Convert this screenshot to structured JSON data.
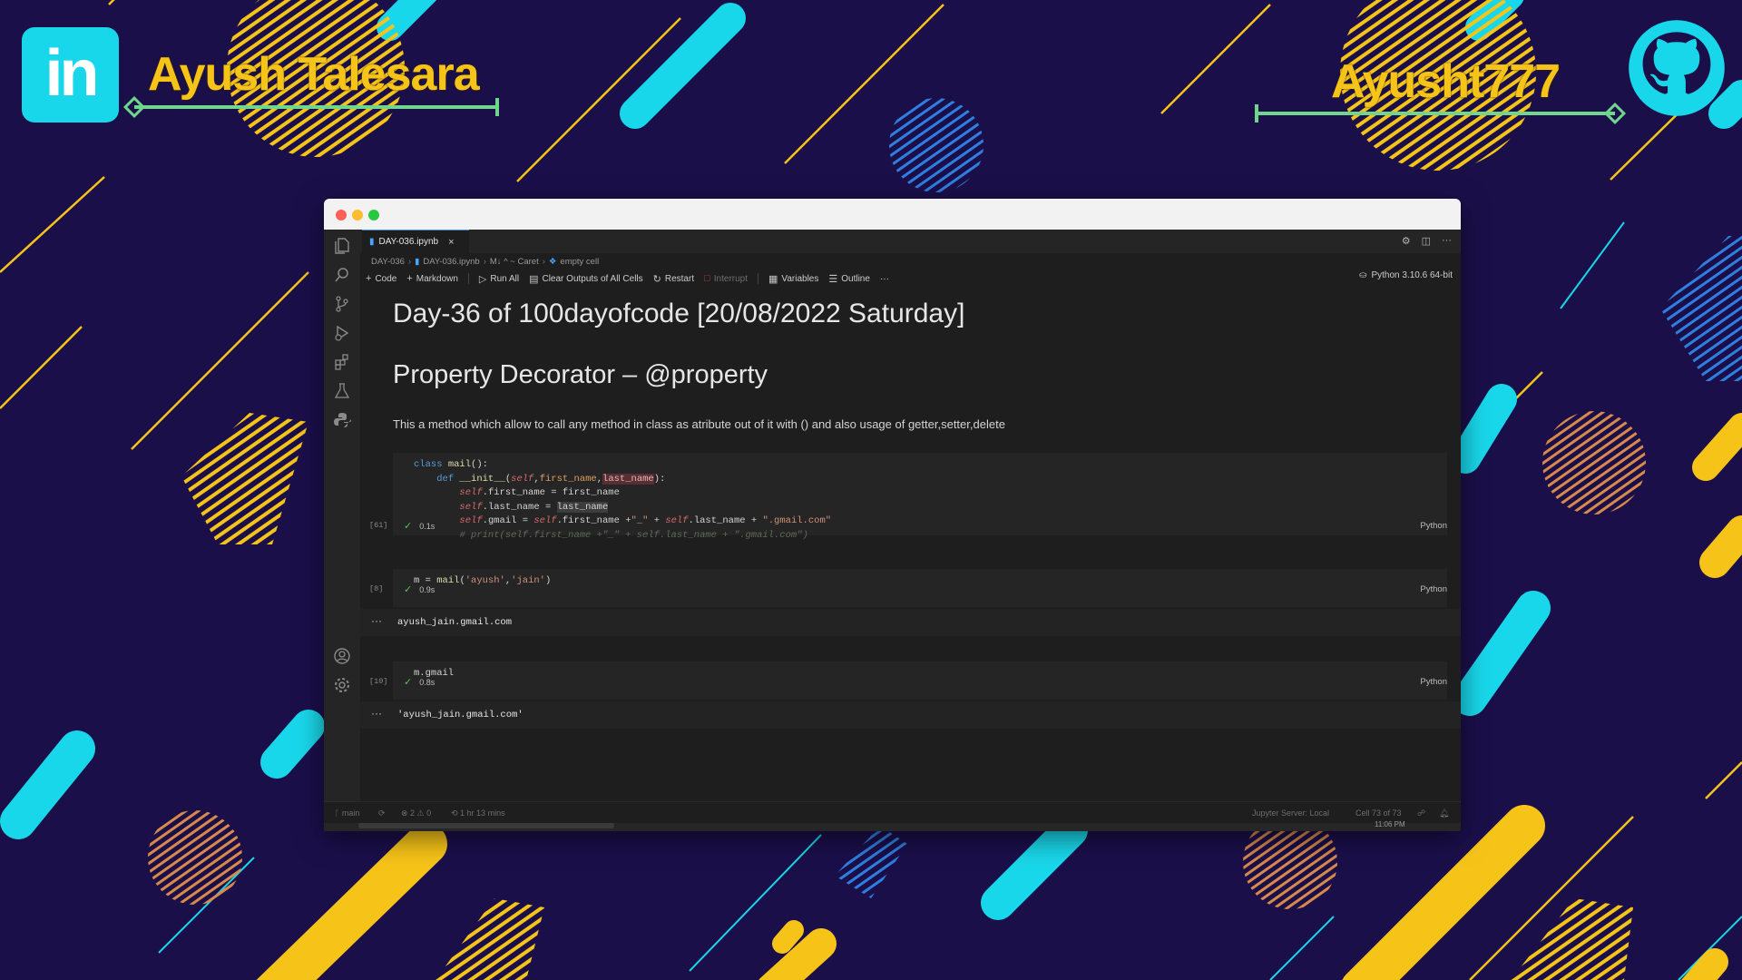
{
  "branding": {
    "left_name": "Ayush Talesara",
    "left_logo_text": "in",
    "right_name": "Ayusht777"
  },
  "colors": {
    "background": "#1b0f4a",
    "accent_yellow": "#f6c419",
    "accent_cyan": "#19d7ea",
    "editor_bg": "#1e1e1e"
  },
  "activity_icons": [
    "explorer-icon",
    "search-icon",
    "source-control-icon",
    "run-debug-icon",
    "extensions-icon",
    "testing-icon",
    "python-icon",
    "account-icon",
    "settings-gear-icon"
  ],
  "tab": {
    "label": "DAY-036.ipynb",
    "close": "×"
  },
  "breadcrumb": {
    "folder": "DAY-036",
    "file": "DAY-036.ipynb",
    "md": "M↓ ^ ~ Caret",
    "cell": "empty cell"
  },
  "toolbar": {
    "code": "Code",
    "markdown": "Markdown",
    "run_all": "Run All",
    "clear_outputs": "Clear Outputs of All Cells",
    "restart": "Restart",
    "interrupt": "Interrupt",
    "variables": "Variables",
    "outline": "Outline",
    "more": "···",
    "kernel": "Python 3.10.6 64-bit"
  },
  "markdown": {
    "h1": "Day-36 of 100dayofcode [20/08/2022 Saturday]",
    "h2": "Property Decorator – @property",
    "para": "This a method which allow to call any method in class as atribute out of it with () and also usage of getter,setter,delete"
  },
  "cells": [
    {
      "exec_count": "[61]",
      "time": "0.1s",
      "lang": "Python",
      "code": {
        "l1_kw": "class",
        "l1_name": " mail",
        "l1_rest": "():",
        "l2_kw": "def",
        "l2_fn": " __init__",
        "l2_open": "(",
        "l2_self": "self",
        "l2_c1": ",",
        "l2_p1": "first_name",
        "l2_c2": ",",
        "l2_p2": "last_name",
        "l2_close": "):",
        "l3_self": "self",
        "l3_rest": ".first_name = first_name",
        "l4_self": "self",
        "l4_mid": ".last_name = ",
        "l4_hl": "last_name",
        "l5_self": "self",
        "l5_a": ".gmail = ",
        "l5_self2": "self",
        "l5_b": ".first_name +",
        "l5_s1": "\"_\"",
        "l5_c": " + ",
        "l5_self3": "self",
        "l5_d": ".last_name + ",
        "l5_s2": "\".gmail.com\"",
        "l6_comment": "# print(self.first_name +\"_\" + self.last_name + \".gmail.com\")"
      }
    },
    {
      "exec_count": "[8]",
      "time": "0.9s",
      "lang": "Python",
      "code": {
        "a": "m = ",
        "fn": "mail",
        "b": "(",
        "s1": "'ayush'",
        "c": ",",
        "s2": "'jain'",
        "d": ")"
      },
      "output": "ayush_jain.gmail.com"
    },
    {
      "exec_count": "[10]",
      "time": "0.8s",
      "lang": "Python",
      "code": {
        "a": "m.gmail"
      },
      "output": "'ayush_jain.gmail.com'"
    }
  ],
  "output_dots": "···",
  "statusbar": {
    "branch": "main",
    "problems": "⊗ 2 ⚠ 0",
    "timer": "1 hr 13 mins",
    "jupyter": "Jupyter Server: Local",
    "cell_pos": "Cell 73 of 73",
    "time": "11:06 PM"
  }
}
